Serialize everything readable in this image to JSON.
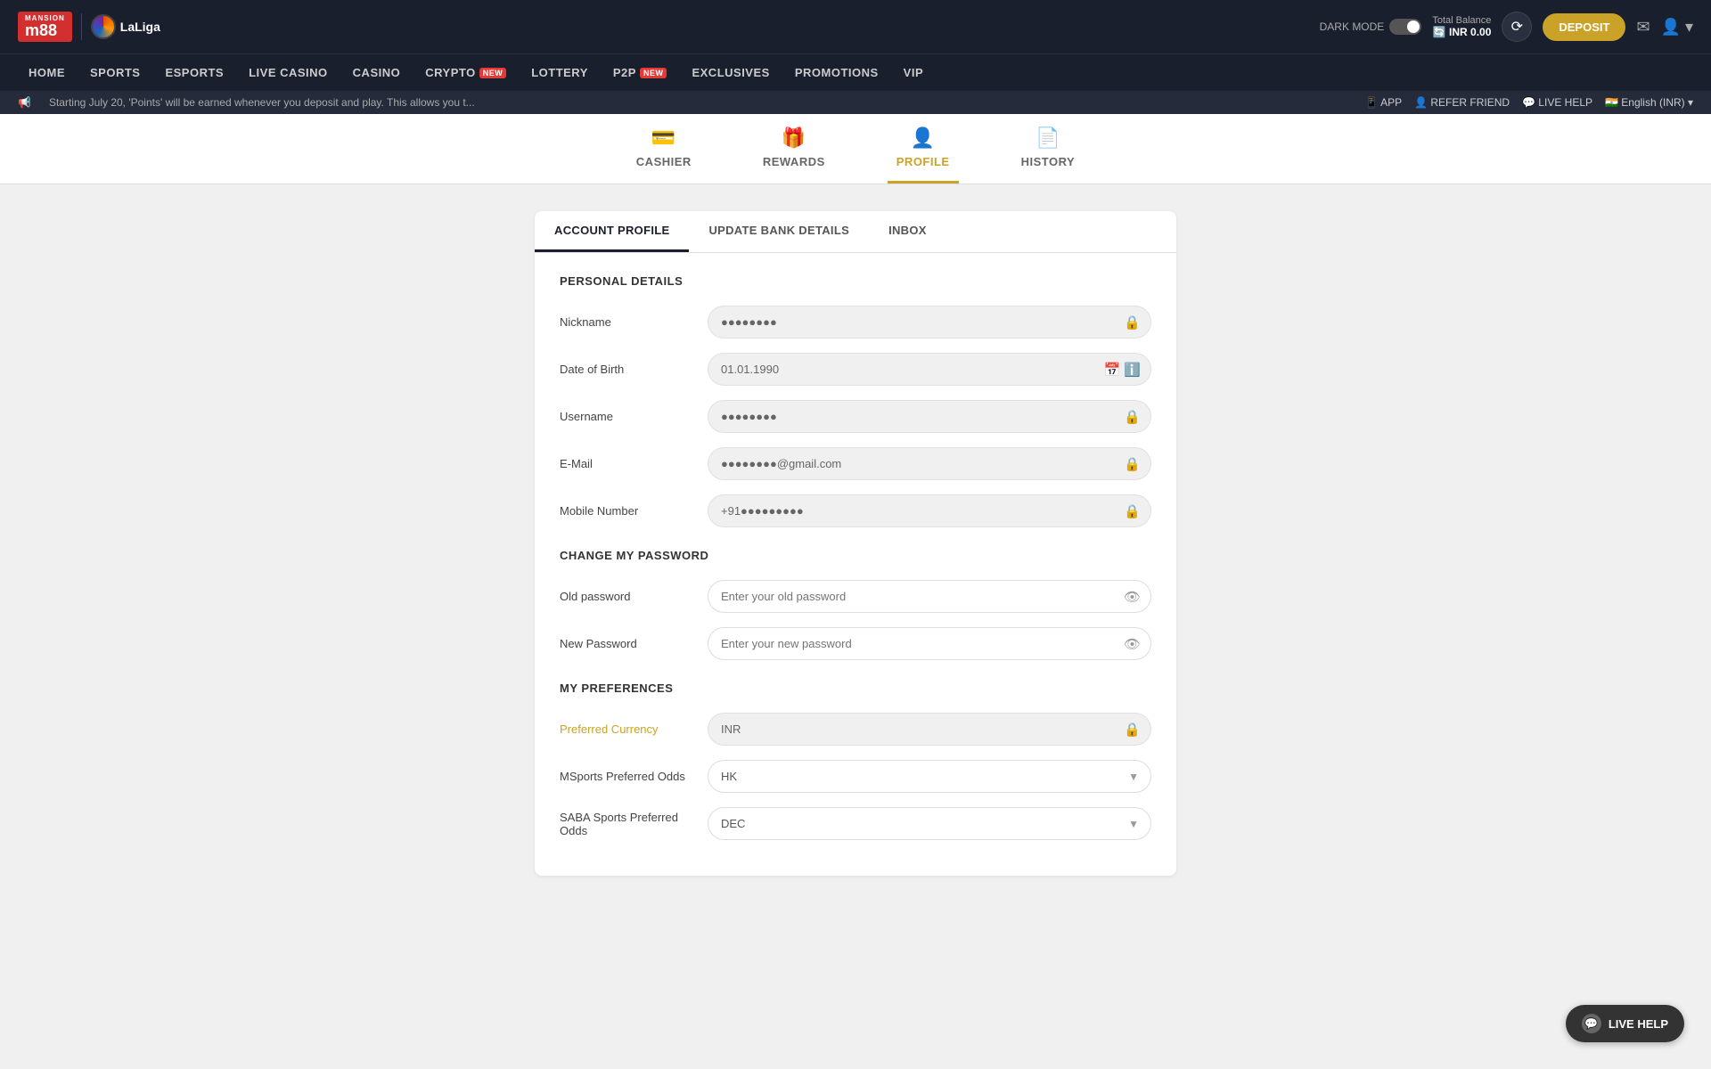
{
  "brand": {
    "logo_text": "m88",
    "logo_sub": "MANSION",
    "laliga_text": "LaLiga"
  },
  "header": {
    "dark_mode_label": "DARK MODE",
    "balance_label": "Total Balance",
    "balance_amount": "INR 0.00",
    "deposit_label": "DEPOSIT"
  },
  "main_nav": {
    "items": [
      {
        "label": "HOME",
        "has_badge": false
      },
      {
        "label": "SPORTS",
        "has_badge": false
      },
      {
        "label": "ESPORTS",
        "has_badge": false
      },
      {
        "label": "LIVE CASINO",
        "has_badge": false
      },
      {
        "label": "CASINO",
        "has_badge": false
      },
      {
        "label": "CRYPTO",
        "has_badge": true,
        "badge_text": "NEW"
      },
      {
        "label": "LOTTERY",
        "has_badge": false
      },
      {
        "label": "P2P",
        "has_badge": true,
        "badge_text": "NEW"
      },
      {
        "label": "EXCLUSIVES",
        "has_badge": false
      },
      {
        "label": "PROMOTIONS",
        "has_badge": false
      },
      {
        "label": "VIP",
        "has_badge": false
      }
    ]
  },
  "ticker": {
    "text": "Starting July 20, 'Points' will be earned whenever you deposit and play. This allows you t...",
    "actions": [
      {
        "label": "APP",
        "icon": "📱"
      },
      {
        "label": "REFER FRIEND",
        "icon": "👤"
      },
      {
        "label": "LIVE HELP",
        "icon": "💬"
      },
      {
        "label": "English (INR)",
        "icon": "🇮🇳"
      }
    ]
  },
  "tabs": [
    {
      "label": "CASHIER",
      "icon": "💳",
      "active": false
    },
    {
      "label": "REWARDS",
      "icon": "🎁",
      "active": false
    },
    {
      "label": "PROFILE",
      "icon": "👤",
      "active": true
    },
    {
      "label": "HISTORY",
      "icon": "📄",
      "active": false
    }
  ],
  "sub_tabs": [
    {
      "label": "ACCOUNT PROFILE",
      "active": true
    },
    {
      "label": "UPDATE BANK DETAILS",
      "active": false
    },
    {
      "label": "INBOX",
      "active": false
    }
  ],
  "personal_details": {
    "section_title": "PERSONAL DETAILS",
    "fields": [
      {
        "label": "Nickname",
        "value": "●●●●●●●●",
        "locked": true,
        "type": "text"
      },
      {
        "label": "Date of Birth",
        "value": "01.01.1990",
        "locked": false,
        "type": "date"
      },
      {
        "label": "Username",
        "value": "●●●●●●●●",
        "locked": true,
        "type": "text"
      },
      {
        "label": "E-Mail",
        "value": "●●●●●●●●@gmail.com",
        "locked": true,
        "type": "text"
      },
      {
        "label": "Mobile Number",
        "value": "+91●●●●●●●●●",
        "locked": true,
        "type": "text"
      }
    ]
  },
  "change_password": {
    "section_title": "CHANGE MY PASSWORD",
    "fields": [
      {
        "label": "Old password",
        "placeholder": "Enter your old password",
        "type": "password"
      },
      {
        "label": "New Password",
        "placeholder": "Enter your new password",
        "type": "password"
      }
    ]
  },
  "preferences": {
    "section_title": "MY PREFERENCES",
    "fields": [
      {
        "label": "Preferred Currency",
        "value": "INR",
        "locked": true,
        "type": "locked-select"
      },
      {
        "label": "MSports Preferred Odds",
        "value": "HK",
        "locked": false,
        "type": "select"
      },
      {
        "label": "SABA Sports Preferred Odds",
        "value": "DEC",
        "locked": false,
        "type": "select"
      }
    ]
  },
  "live_help": {
    "label": "LIVE HELP"
  }
}
